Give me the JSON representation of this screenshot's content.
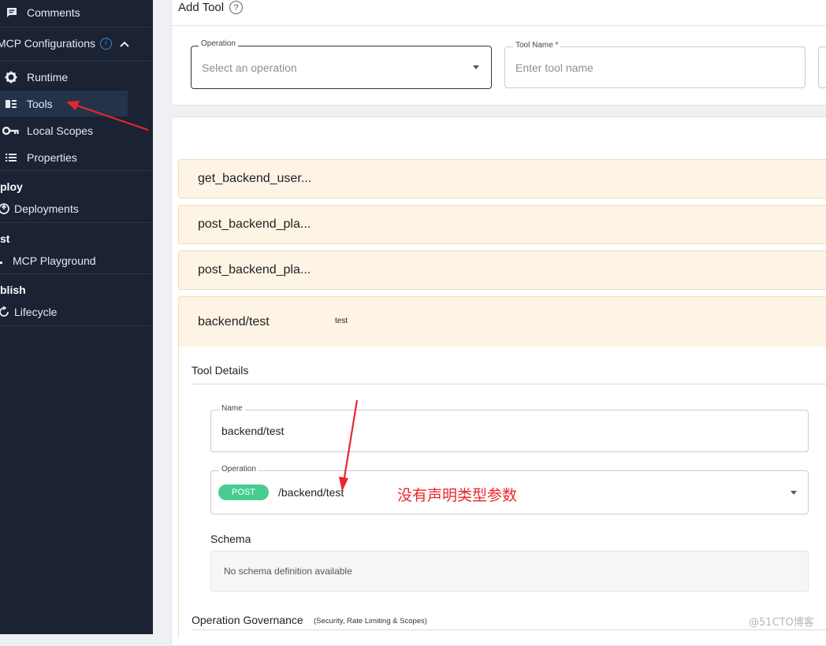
{
  "sidebar": {
    "comments": "Comments",
    "mcp_configurations": "MCP Configurations",
    "mcp_info": "i",
    "items": [
      {
        "label": "Runtime"
      },
      {
        "label": "Tools"
      },
      {
        "label": "Local Scopes"
      },
      {
        "label": "Properties"
      }
    ],
    "deploy_heading": "ploy",
    "deployments": "Deployments",
    "test_heading": "st",
    "mcp_playground": "MCP Playground",
    "publish_heading": "blish",
    "lifecycle": "Lifecycle"
  },
  "add_tool": {
    "title": "Add Tool",
    "help": "?",
    "operation_label": "Operation",
    "operation_placeholder": "Select an operation",
    "tool_name_label": "Tool Name *",
    "tool_name_placeholder": "Enter tool name"
  },
  "tools": [
    {
      "name": "get_backend_user..."
    },
    {
      "name": "post_backend_pla..."
    },
    {
      "name": "post_backend_pla..."
    },
    {
      "name": "backend/test",
      "description": "test"
    }
  ],
  "tool_details": {
    "heading": "Tool Details",
    "name_label": "Name",
    "name_value": "backend/test",
    "operation_label": "Operation",
    "method": "POST",
    "path": "/backend/test",
    "schema_heading": "Schema",
    "schema_empty": "No schema definition available",
    "governance_heading": "Operation Governance",
    "governance_sub": "(Security, Rate Limiting & Scopes)"
  },
  "annotation": "没有声明类型参数",
  "watermark": "@51CTO博客",
  "colors": {
    "sidebar_bg": "#1a2233",
    "post_badge": "#49cc90",
    "accordion_bg": "#fdf4e6",
    "annotation": "#e8272a"
  }
}
